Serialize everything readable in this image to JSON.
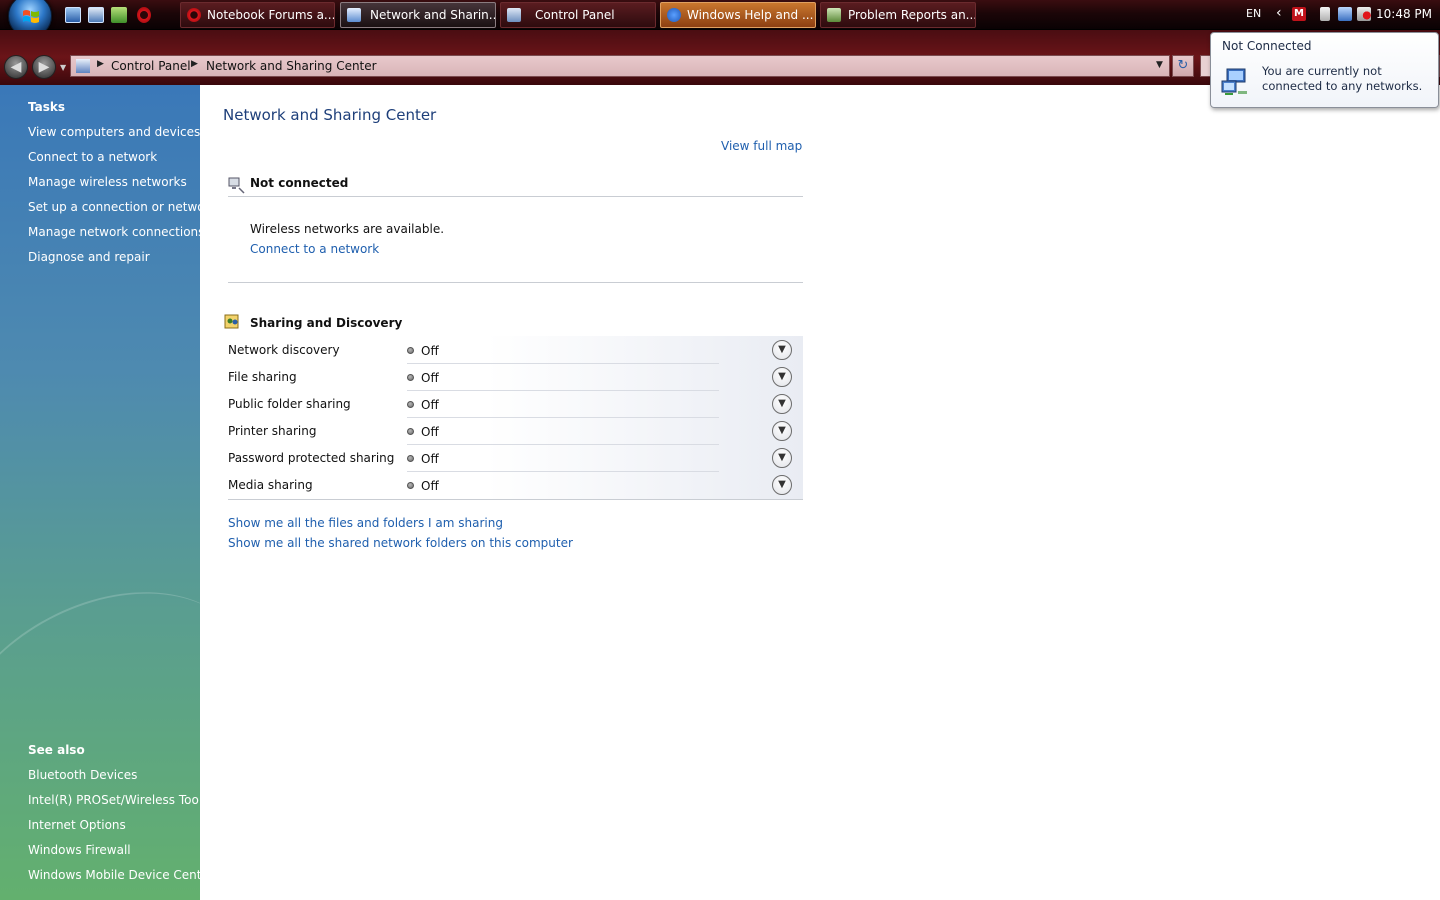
{
  "taskbar": {
    "tasks": [
      {
        "label": "Notebook Forums a...",
        "icon": "opera-icon"
      },
      {
        "label": "Network and Sharin...",
        "icon": "network-center-icon"
      },
      {
        "label": "Control Panel",
        "icon": "control-panel-icon"
      },
      {
        "label": "Windows Help and ...",
        "icon": "help-icon"
      },
      {
        "label": "Problem Reports an...",
        "icon": "problem-reports-icon"
      }
    ],
    "language": "EN",
    "clock": "10:48 PM"
  },
  "address_bar": {
    "breadcrumb": [
      "Control Panel",
      "Network and Sharing Center"
    ]
  },
  "sidebar": {
    "tasks_heading": "Tasks",
    "tasks": [
      "View computers and devices",
      "Connect to a network",
      "Manage wireless networks",
      "Set up a connection or network",
      "Manage network connections",
      "Diagnose and repair"
    ],
    "see_also_heading": "See also",
    "see_also": [
      "Bluetooth Devices",
      "Intel(R) PROSet/Wireless Tools",
      "Internet Options",
      "Windows Firewall",
      "Windows Mobile Device Center"
    ]
  },
  "main": {
    "title": "Network and Sharing Center",
    "view_full_map": "View full map",
    "connection": {
      "status": "Not connected",
      "message": "Wireless networks are available.",
      "connect_link": "Connect to a network"
    },
    "sharing": {
      "heading": "Sharing and Discovery",
      "rows": [
        {
          "label": "Network discovery",
          "value": "Off"
        },
        {
          "label": "File sharing",
          "value": "Off"
        },
        {
          "label": "Public folder sharing",
          "value": "Off"
        },
        {
          "label": "Printer sharing",
          "value": "Off"
        },
        {
          "label": "Password protected sharing",
          "value": "Off"
        },
        {
          "label": "Media sharing",
          "value": "Off"
        }
      ]
    },
    "links": [
      "Show me all the files and folders I am sharing",
      "Show me all the shared network folders on this computer"
    ]
  },
  "balloon": {
    "title": "Not Connected",
    "message": "You are currently not connected to any networks."
  }
}
